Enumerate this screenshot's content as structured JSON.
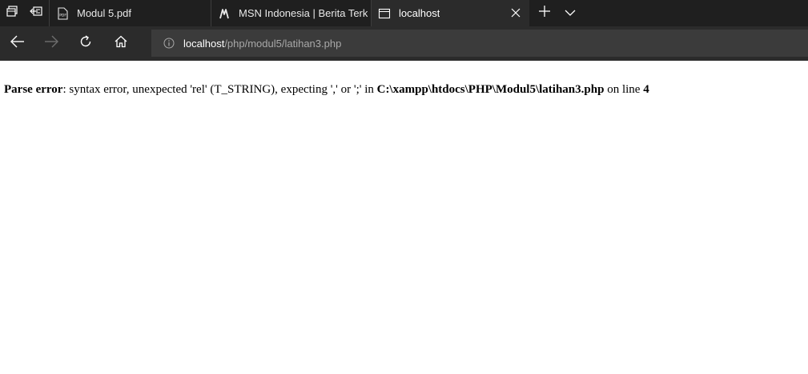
{
  "browser": {
    "tabs": [
      {
        "label": "Modul 5.pdf",
        "icon": "pdf-icon",
        "active": false
      },
      {
        "label": "MSN Indonesia | Berita Terk",
        "icon": "msn-icon",
        "active": false
      },
      {
        "label": "localhost",
        "icon": "page-icon",
        "active": true
      }
    ],
    "toolbar_icons": [
      "tab-preview-icon",
      "set-aside-tabs-icon",
      "new-tab-icon",
      "tab-list-chevron-icon"
    ],
    "address": {
      "host": "localhost",
      "path": "/php/modul5/latihan3.php"
    },
    "colors": {
      "tabbar": "#1f1f1f",
      "navbar": "#2b2b2b",
      "addressbar": "#3b3b3b"
    }
  },
  "page": {
    "error": {
      "label": "Parse error",
      "message": ": syntax error, unexpected 'rel' (T_STRING), expecting ',' or ';' in ",
      "file": "C:\\xampp\\htdocs\\PHP\\Modul5\\latihan3.php",
      "line_prefix": " on line ",
      "line_number": "4"
    }
  }
}
